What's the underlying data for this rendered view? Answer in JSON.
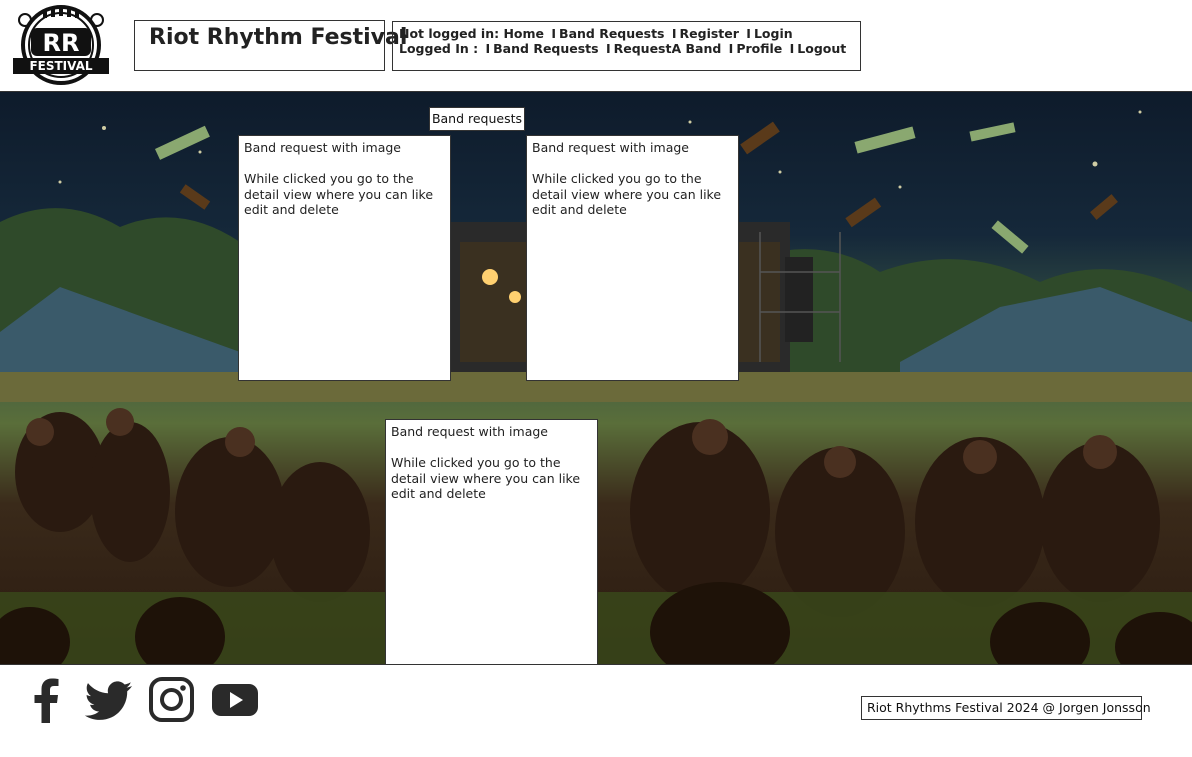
{
  "header": {
    "logo_text": "RR FESTIVAL",
    "site_title": "Riot Rhythm Festival",
    "nav": {
      "logged_out_label": "Not logged in:",
      "logged_out_links": [
        "Home",
        "Band Requests",
        "Register",
        "Login"
      ],
      "logged_in_label": "Logged In :",
      "logged_in_links": [
        "Band Requests",
        "RequestA Band",
        "Profile",
        "Logout"
      ]
    }
  },
  "main": {
    "section_label": "Band requests",
    "cards": [
      {
        "title": "Band request with image",
        "description": "While clicked you go to the detail view where you can like edit and delete"
      },
      {
        "title": "Band request with image",
        "description": "While clicked you go to the detail view where you can like edit and delete"
      },
      {
        "title": "Band request with image",
        "description": "While clicked you go to the detail view where you can like edit and delete"
      }
    ]
  },
  "footer": {
    "social_icons": [
      "facebook-icon",
      "twitter-icon",
      "instagram-icon",
      "youtube-icon"
    ],
    "copyright": "Riot Rhythms Festival 2024 @ Jorgen Jonsson"
  },
  "colors": {
    "border": "#333333",
    "text": "#222222",
    "background": "#ffffff"
  }
}
